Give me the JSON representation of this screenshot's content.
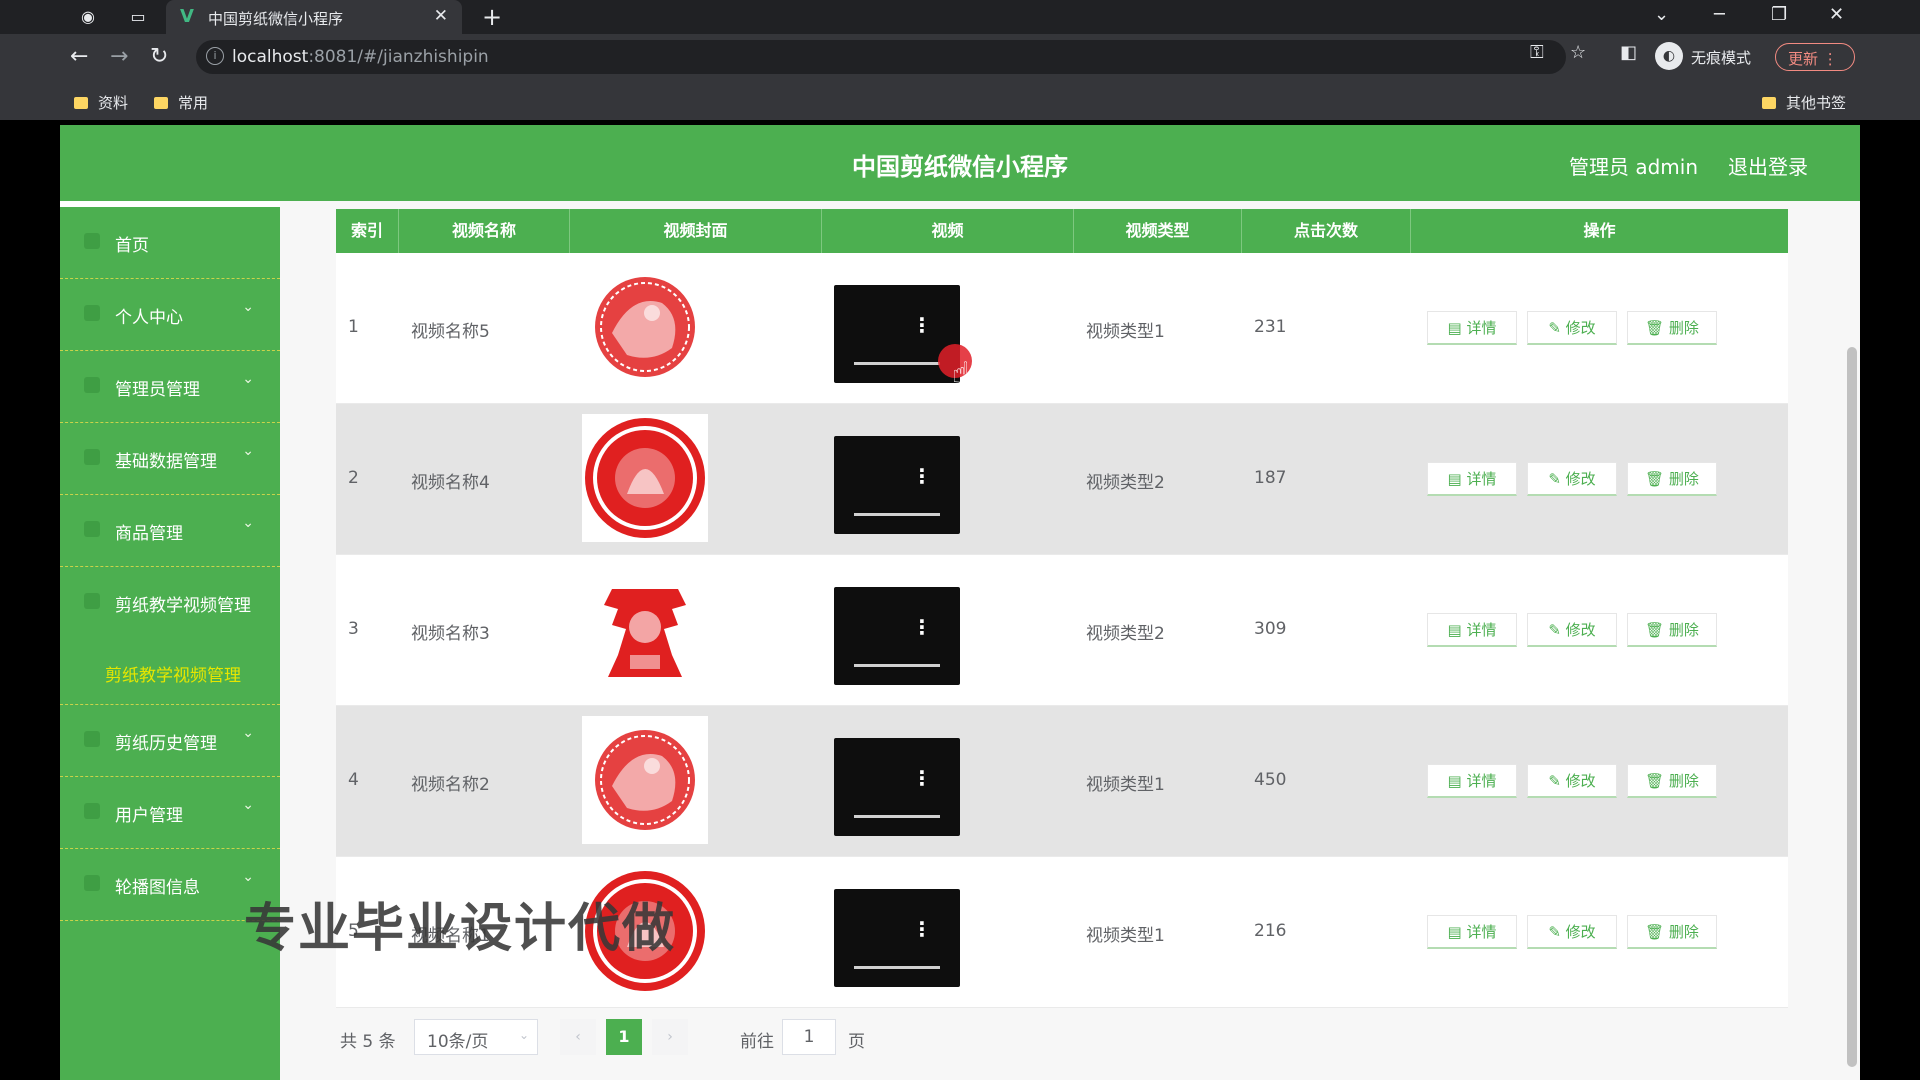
{
  "browser": {
    "tab_title": "中国剪纸微信小程序",
    "url_host": "localhost",
    "url_rest": ":8081/#/jianzhishipin",
    "incognito_label": "无痕模式",
    "update_label": "更新",
    "bookmarks": [
      "资料",
      "常用"
    ],
    "other_bookmarks": "其他书签"
  },
  "header": {
    "title": "中国剪纸微信小程序",
    "user": "管理员 admin",
    "logout": "退出登录"
  },
  "sidebar": {
    "items": [
      {
        "label": "首页",
        "has_chevron": false
      },
      {
        "label": "个人中心",
        "has_chevron": true
      },
      {
        "label": "管理员管理",
        "has_chevron": true
      },
      {
        "label": "基础数据管理",
        "has_chevron": true
      },
      {
        "label": "商品管理",
        "has_chevron": true
      },
      {
        "label": "剪纸教学视频管理",
        "has_chevron": false
      },
      {
        "label": "剪纸历史管理",
        "has_chevron": true
      },
      {
        "label": "用户管理",
        "has_chevron": true
      },
      {
        "label": "轮播图信息",
        "has_chevron": true
      }
    ],
    "active_sub": "剪纸教学视频管理"
  },
  "table": {
    "headers": [
      "索引",
      "视频名称",
      "视频封面",
      "视频",
      "视频类型",
      "点击次数",
      "操作"
    ],
    "rows": [
      {
        "index": "1",
        "name": "视频名称5",
        "type": "视频类型1",
        "clicks": "231",
        "cover": "round-red-papercut"
      },
      {
        "index": "2",
        "name": "视频名称4",
        "type": "视频类型2",
        "clicks": "187",
        "cover": "circular-seal-papercut"
      },
      {
        "index": "3",
        "name": "视频名称3",
        "type": "视频类型2",
        "clicks": "309",
        "cover": "figure-papercut"
      },
      {
        "index": "4",
        "name": "视频名称2",
        "type": "视频类型1",
        "clicks": "450",
        "cover": "round-red-papercut"
      },
      {
        "index": "5",
        "name": "视频名称1",
        "type": "视频类型1",
        "clicks": "216",
        "cover": "circular-seal-papercut"
      }
    ],
    "actions": {
      "detail": "详情",
      "edit": "修改",
      "delete": "删除"
    }
  },
  "pager": {
    "total": "共 5 条",
    "page_size": "10条/页",
    "current": "1",
    "goto_label": "前往",
    "goto_value": "1",
    "page_suffix": "页"
  },
  "watermark": "专业毕业设计代做",
  "colors": {
    "brand_green": "#4caf50",
    "active_yellow": "#e6e600",
    "cover_red": "#e02020"
  }
}
